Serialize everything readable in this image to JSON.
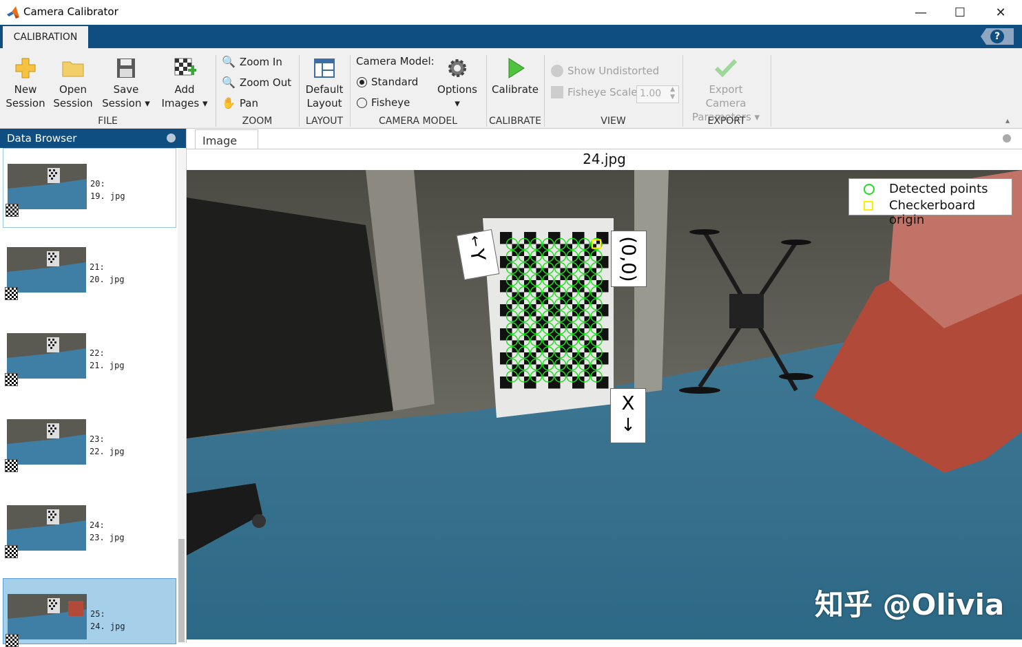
{
  "window": {
    "title": "Camera Calibrator"
  },
  "tabs": {
    "calibration": "CALIBRATION",
    "help": "?"
  },
  "ribbon": {
    "new_session": [
      "New",
      "Session"
    ],
    "open_session": [
      "Open",
      "Session"
    ],
    "save_session": [
      "Save",
      "Session"
    ],
    "add_images": [
      "Add",
      "Images"
    ],
    "zoom_in": "Zoom In",
    "zoom_out": "Zoom Out",
    "pan": "Pan",
    "default_layout": [
      "Default",
      "Layout"
    ],
    "camera_model_label": "Camera Model:",
    "standard": "Standard",
    "fisheye": "Fisheye",
    "options": "Options",
    "calibrate": "Calibrate",
    "show_undistorted": "Show Undistorted",
    "fisheye_scale": "Fisheye Scale",
    "fisheye_scale_value": "1.00",
    "export_camera": [
      "Export Camera",
      "Parameters"
    ],
    "groups": {
      "file": "FILE",
      "zoom": "ZOOM",
      "layout": "LAYOUT",
      "camera_model": "CAMERA MODEL",
      "calibrate": "CALIBRATE",
      "view": "VIEW",
      "export": "EXPORT"
    },
    "selected_camera_model": "Standard"
  },
  "data_browser": {
    "title": "Data Browser",
    "items": [
      {
        "index": "20:",
        "file": "19. jpg"
      },
      {
        "index": "21:",
        "file": "20. jpg"
      },
      {
        "index": "22:",
        "file": "21. jpg"
      },
      {
        "index": "23:",
        "file": "22. jpg"
      },
      {
        "index": "24:",
        "file": "23. jpg"
      },
      {
        "index": "25:",
        "file": "24. jpg"
      }
    ],
    "selected_index": 5
  },
  "image_view": {
    "tab": "Image",
    "title": "24.jpg",
    "legend": {
      "detected": "Detected points",
      "origin": "Checkerboard origin"
    },
    "labels": {
      "y_axis": "Y",
      "x_axis": "X",
      "origin": "(0,0)"
    },
    "colors": {
      "detected": "#22dd22",
      "origin": "#ffee00"
    }
  },
  "watermark": "知乎 @Olivia",
  "colors": {
    "accent": "#0f4e80",
    "selection": "#a6cfea"
  }
}
